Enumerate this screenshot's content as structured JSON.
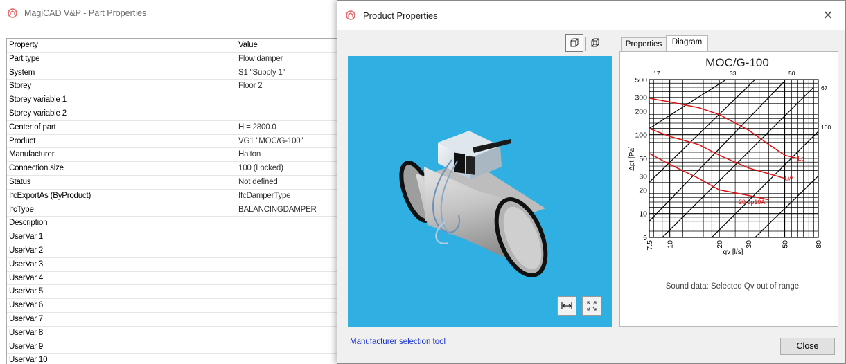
{
  "background_window": {
    "title": "MagiCAD V&P - Part Properties",
    "table": {
      "headers": [
        "Property",
        "Value"
      ],
      "rows": [
        [
          "Part type",
          "Flow damper"
        ],
        [
          "System",
          "S1 \"Supply 1\""
        ],
        [
          "Storey",
          "Floor 2"
        ],
        [
          "Storey variable 1",
          ""
        ],
        [
          "Storey variable 2",
          ""
        ],
        [
          "Center of part",
          "H = 2800.0"
        ],
        [
          "Product",
          "VG1 \"MOC/G-100\""
        ],
        [
          "Manufacturer",
          "Halton"
        ],
        [
          "Connection size",
          "100 (Locked)"
        ],
        [
          "Status",
          "Not defined"
        ],
        [
          "IfcExportAs (ByProduct)",
          "IfcDamperType"
        ],
        [
          "IfcType",
          "BALANCINGDAMPER"
        ],
        [
          "Description",
          ""
        ],
        [
          "UserVar 1",
          ""
        ],
        [
          "UserVar 2",
          ""
        ],
        [
          "UserVar 3",
          ""
        ],
        [
          "UserVar 4",
          ""
        ],
        [
          "UserVar 5",
          ""
        ],
        [
          "UserVar 6",
          ""
        ],
        [
          "UserVar 7",
          ""
        ],
        [
          "UserVar 8",
          ""
        ],
        [
          "UserVar 9",
          ""
        ],
        [
          "UserVar 10",
          ""
        ]
      ]
    }
  },
  "dialog": {
    "title": "Product Properties",
    "close_glyph": "✕",
    "view_buttons": [
      "solid-view-icon",
      "wireframe-view-icon"
    ],
    "viewport": {
      "background_color": "#30b0e2"
    },
    "viewport_buttons": [
      "fit-width-icon",
      "fullscreen-icon"
    ],
    "tabs": [
      {
        "label": "Properties",
        "active": false
      },
      {
        "label": "Diagram",
        "active": true
      }
    ],
    "manufacturer_link": "Manufacturer selection tool",
    "close_button": "Close",
    "diagram": {
      "title": "MOC/G-100",
      "y_label": "Δpt [Pa]",
      "x_label": "qv [l/s]",
      "x_ticks": [
        "7.5",
        "10",
        "20",
        "30",
        "50",
        "80"
      ],
      "y_ticks": [
        "5",
        "10",
        "20",
        "30",
        "50",
        "100",
        "200",
        "300",
        "500"
      ],
      "top_labels": [
        "17",
        "33",
        "50",
        "67",
        "100"
      ],
      "curve_labels": [
        "Ld",
        "Lw",
        "20 Lp10A"
      ],
      "sound_note": "Sound data: Selected Qv out of range",
      "curve_color": "#e01010"
    }
  }
}
